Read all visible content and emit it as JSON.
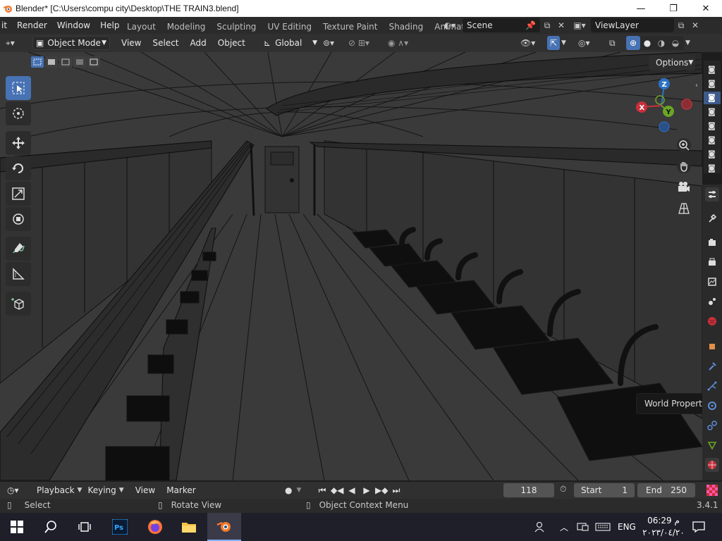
{
  "window": {
    "title": "Blender* [C:\\Users\\compu city\\Desktop\\THE TRAIN3.blend]",
    "minimize": "—",
    "maximize": "❐",
    "close": "✕"
  },
  "menu": {
    "items": [
      "it",
      "Render",
      "Window",
      "Help"
    ],
    "workspace_tabs": [
      "Layout",
      "Modeling",
      "Sculpting",
      "UV Editing",
      "Texture Paint",
      "Shading",
      "Animati"
    ],
    "scene": "Scene",
    "view_layer": "ViewLayer"
  },
  "viewport_header": {
    "mode": "Object Mode",
    "menus": [
      "View",
      "Select",
      "Add",
      "Object"
    ],
    "transform_orientation": "Global",
    "options": "Options"
  },
  "gizmo": {
    "x_label": "X",
    "y_label": "Y",
    "z_label": "Z",
    "x_color": "#c9303c",
    "y_color": "#6aa526",
    "z_color": "#2c72c5"
  },
  "tooltip": "World Properties",
  "timeline": {
    "menus": [
      "Playback",
      "Keying",
      "View",
      "Marker"
    ],
    "current_frame": "118",
    "start_label": "Start",
    "start_value": "1",
    "end_label": "End",
    "end_value": "250"
  },
  "status": {
    "select": "Select",
    "rotate": "Rotate View",
    "context": "Object Context Menu",
    "version": "3.4.1"
  },
  "taskbar": {
    "lang": "ENG",
    "time": "06:29 م",
    "date": "٢٠٢٣/٠٤/٢٠"
  },
  "colors": {
    "accent": "#4772b3",
    "viewport_bg": "#3a3a3a",
    "wire": "#101010"
  }
}
